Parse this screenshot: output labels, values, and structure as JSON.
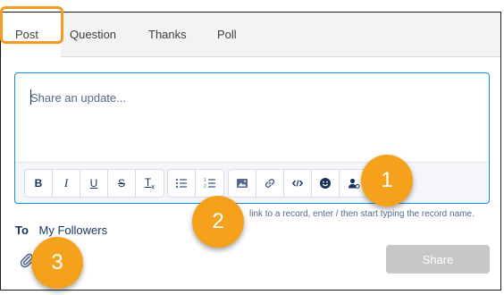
{
  "tabs": [
    {
      "label": "Post"
    },
    {
      "label": "Question"
    },
    {
      "label": "Thanks"
    },
    {
      "label": "Poll"
    }
  ],
  "composer": {
    "placeholder": "Share an update..."
  },
  "toolbar": {
    "format_buttons": [
      {
        "icon": "bold-icon",
        "glyph": "B"
      },
      {
        "icon": "italic-icon",
        "glyph": "I"
      },
      {
        "icon": "underline-icon",
        "glyph": "U"
      },
      {
        "icon": "strikethrough-icon",
        "glyph": "S"
      },
      {
        "icon": "clear-formatting-icon",
        "glyph": "Tx"
      }
    ],
    "list_buttons": [
      {
        "icon": "bulleted-list-icon"
      },
      {
        "icon": "numbered-list-icon"
      }
    ],
    "insert_buttons": [
      {
        "icon": "image-icon"
      },
      {
        "icon": "link-icon"
      },
      {
        "icon": "code-icon"
      },
      {
        "icon": "emoji-icon"
      },
      {
        "icon": "mention-icon"
      }
    ]
  },
  "hint": "link to a record, enter / then start typing the record name.",
  "audience": {
    "label": "To",
    "value": "My Followers"
  },
  "share_label": "Share",
  "callouts": [
    "1",
    "2",
    "3"
  ],
  "colors": {
    "callout": "#f5a11c",
    "focus_ring": "#f59a23",
    "share_disabled": "#c9c7c5",
    "composer_border": "#1589ee"
  }
}
